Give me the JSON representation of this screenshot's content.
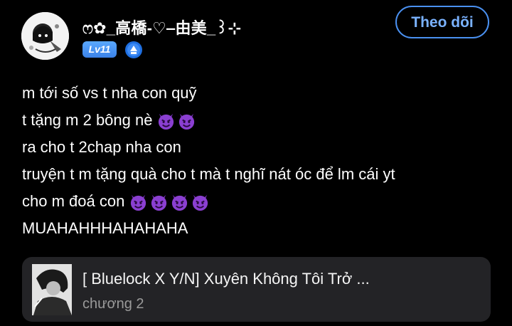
{
  "user": {
    "username": "ෆ✿_高橋-♡‒由美_꒱⊹",
    "level": "Lv11",
    "avatar_icon": "avatar-icon",
    "badge_icon": "verified-badge-icon"
  },
  "follow_button": {
    "label": "Theo dõi"
  },
  "comment": {
    "lines": [
      {
        "text": "m tới số vs t nha con quỹ",
        "emoji_count": 0
      },
      {
        "text": "t tặng m 2 bông nè",
        "emoji_count": 2
      },
      {
        "text": "ra cho t 2chap nha con",
        "emoji_count": 0
      },
      {
        "text": "truyện t m tặng quà cho t mà t nghĩ nát óc để lm cái yt",
        "emoji_count": 0
      },
      {
        "text": "cho m đoá con",
        "emoji_count": 4
      },
      {
        "text": "MUAHAHHHAHAHAHA",
        "emoji_count": 0
      }
    ],
    "emoji_icon": "smiling-devil-icon"
  },
  "story": {
    "title": "[ Bluelock X Y/N] Xuyên Không Tôi Trở ...",
    "chapter": "chương 2",
    "cover_icon": "story-cover-image"
  },
  "colors": {
    "background": "#000000",
    "accent": "#4a90f0",
    "card": "#232326",
    "devil": "#8a3fd1"
  }
}
